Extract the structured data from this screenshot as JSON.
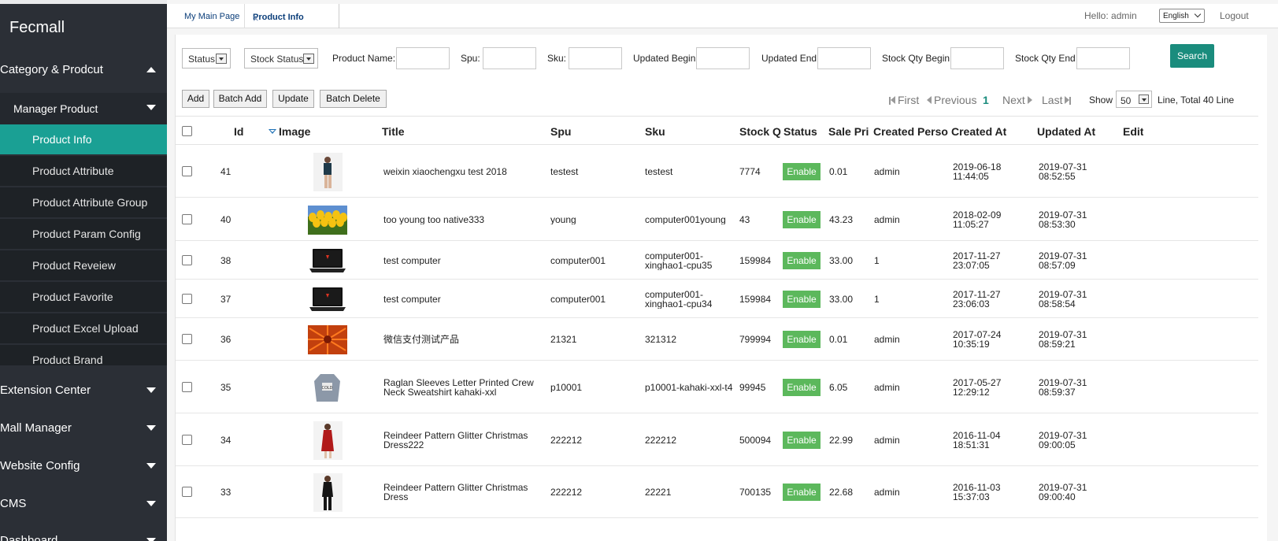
{
  "sidebar": {
    "brand": "Fecmall",
    "groups": [
      {
        "label": "Category & Prodcut"
      },
      {
        "label": "Extension Center"
      },
      {
        "label": "Mall Manager"
      },
      {
        "label": "Website Config"
      },
      {
        "label": "CMS"
      },
      {
        "label": "Dashboard"
      }
    ],
    "submenu_head": "Manager Product",
    "items": [
      {
        "label": "Product Info",
        "active": true
      },
      {
        "label": "Product Attribute"
      },
      {
        "label": "Product Attribute Group"
      },
      {
        "label": "Product Param Config"
      },
      {
        "label": "Product Reveiew"
      },
      {
        "label": "Product Favorite"
      },
      {
        "label": "Product Excel Upload"
      },
      {
        "label": "Product Brand"
      }
    ]
  },
  "tabs": [
    {
      "label": "My Main Page"
    },
    {
      "label": "Product Info",
      "close": "×"
    }
  ],
  "header": {
    "hello": "Hello: admin",
    "language": "English",
    "logout": "Logout"
  },
  "filters": {
    "status": "Status",
    "stock_status": "Stock Status",
    "product_name": "Product Name:",
    "spu": "Spu:",
    "sku": "Sku:",
    "updated_begin": "Updated Begin",
    "updated_end": "Updated End",
    "stock_qty_begin": "Stock Qty Begin",
    "stock_qty_end": "Stock Qty End",
    "search": "Search"
  },
  "actions": {
    "add": "Add",
    "batch_add": "Batch Add",
    "update": "Update",
    "batch_delete": "Batch Delete"
  },
  "pager": {
    "first": "First",
    "previous": "Previous",
    "current": "1",
    "next": "Next",
    "last": "Last",
    "show": "Show",
    "page_size": "50",
    "total": "Line, Total 40 Line"
  },
  "table": {
    "columns": [
      "Id",
      "Image",
      "Title",
      "Spu",
      "Sku",
      "Stock Q",
      "Status",
      "Sale Pri",
      "Created Perso",
      "Created At",
      "Updated At",
      "Edit"
    ],
    "rows": [
      {
        "id": "41",
        "title": [
          "weixin xiaochengxu test 2018"
        ],
        "spu": "testest",
        "sku": [
          "testest"
        ],
        "stock": "7774",
        "status": "Enable",
        "price": "0.01",
        "creator": "admin",
        "created": [
          "2019-06-18",
          "11:44:05"
        ],
        "updated": [
          "2019-07-31",
          "08:52:55"
        ],
        "img": "model-dark"
      },
      {
        "id": "40",
        "title": [
          "too young too native333"
        ],
        "spu": "young",
        "sku": [
          "computer001young"
        ],
        "stock": "43",
        "status": "Enable",
        "price": "43.23",
        "creator": "admin",
        "created": [
          "2018-02-09",
          "11:05:27"
        ],
        "updated": [
          "2019-07-31",
          "08:53:30"
        ],
        "img": "tulips"
      },
      {
        "id": "38",
        "title": [
          "test computer"
        ],
        "spu": "computer001",
        "sku": [
          "computer001-",
          "xinghao1-cpu35"
        ],
        "stock": "159984",
        "status": "Enable",
        "price": "33.00",
        "creator": "1",
        "created": [
          "2017-11-27",
          "23:07:05"
        ],
        "updated": [
          "2019-07-31",
          "08:57:09"
        ],
        "img": "laptop"
      },
      {
        "id": "37",
        "title": [
          "test computer"
        ],
        "spu": "computer001",
        "sku": [
          "computer001-",
          "xinghao1-cpu34"
        ],
        "stock": "159984",
        "status": "Enable",
        "price": "33.00",
        "creator": "1",
        "created": [
          "2017-11-27",
          "23:06:03"
        ],
        "updated": [
          "2019-07-31",
          "08:58:54"
        ],
        "img": "laptop"
      },
      {
        "id": "36",
        "title": [
          "微信支付测试产品"
        ],
        "spu": "21321",
        "sku": [
          "321312"
        ],
        "stock": "799994",
        "status": "Enable",
        "price": "0.01",
        "creator": "admin",
        "created": [
          "2017-07-24",
          "10:35:19"
        ],
        "updated": [
          "2019-07-31",
          "08:59:21"
        ],
        "img": "flower"
      },
      {
        "id": "35",
        "title": [
          "Raglan Sleeves Letter Printed Crew",
          "Neck Sweatshirt kahaki-xxl"
        ],
        "spu": "p10001",
        "sku": [
          "p10001-kahaki-xxl-t4"
        ],
        "stock": "99945",
        "status": "Enable",
        "price": "6.05",
        "creator": "admin",
        "created": [
          "2017-05-27",
          "12:29:12"
        ],
        "updated": [
          "2019-07-31",
          "08:59:37"
        ],
        "img": "sweatshirt"
      },
      {
        "id": "34",
        "title": [
          "Reindeer Pattern Glitter Christmas",
          "Dress222"
        ],
        "spu": "222212",
        "sku": [
          "222212"
        ],
        "stock": "500094",
        "status": "Enable",
        "price": "22.99",
        "creator": "admin",
        "created": [
          "2016-11-04",
          "18:51:31"
        ],
        "updated": [
          "2019-07-31",
          "09:00:05"
        ],
        "img": "red-dress"
      },
      {
        "id": "33",
        "title": [
          "Reindeer Pattern Glitter Christmas",
          "Dress"
        ],
        "spu": "222212",
        "sku": [
          "22221"
        ],
        "stock": "700135",
        "status": "Enable",
        "price": "22.68",
        "creator": "admin",
        "created": [
          "2016-11-03",
          "15:37:03"
        ],
        "updated": [
          "2019-07-31",
          "09:00:40"
        ],
        "img": "black-dress"
      }
    ]
  }
}
